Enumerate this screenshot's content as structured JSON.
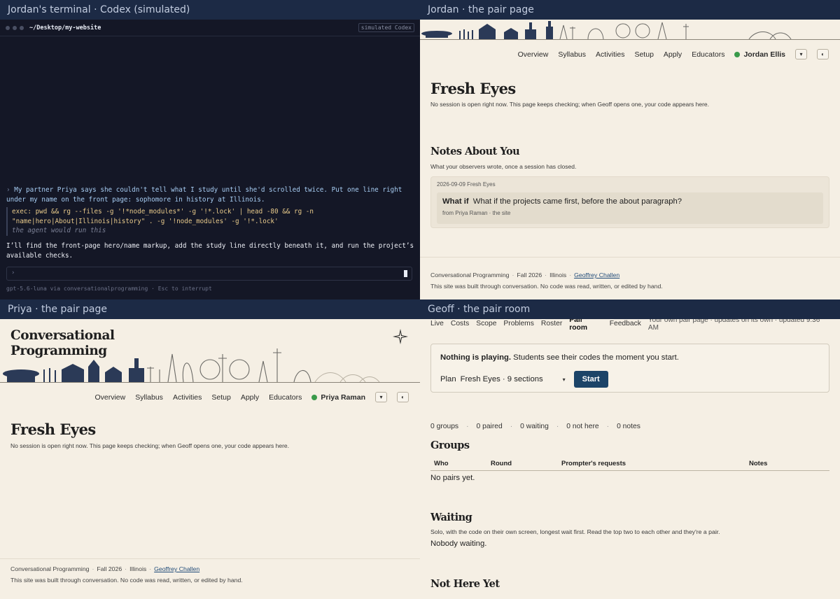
{
  "panes": {
    "tl_title": "Jordan's terminal · Codex (simulated)",
    "tr_title": "Jordan · the pair page",
    "bl_title": "Priya · the pair page",
    "br_title": "Geoff · the pair room"
  },
  "terminal": {
    "path": "~/Desktop/my-website",
    "badge": "simulated Codex",
    "prompt_chevron": "›",
    "user_message": "My partner Priya says she couldn't tell what I study until she'd scrolled twice. Put one line right under my name on the front page: sophomore in history at Illinois.",
    "exec_line": "exec: pwd && rg --files -g '!*node_modules*' -g '!*.lock' | head -80 && rg -n \"name|hero|About|Illinois|history\" . -g '!node_modules' -g '!*.lock'",
    "exec_hint": "the agent would run this",
    "reply": "I’ll find the front-page hero/name markup, add the study line directly beneath it, and run the project’s available checks.",
    "input_prompt": "›",
    "status": "gpt-5.6-luna via conversationalprogramming  ·  Esc to interrupt"
  },
  "site": {
    "nav": [
      "Overview",
      "Syllabus",
      "Activities",
      "Setup",
      "Apply",
      "Educators"
    ],
    "logo_line1": "Conversational",
    "logo_line2": "Programming",
    "footer_course": "Conversational Programming",
    "footer_term": "Fall 2026",
    "footer_place": "Illinois",
    "footer_author": "Geoffrey Challen",
    "footer_note": "This site was built through conversation. No code was read, written, or edited by hand.",
    "caret": "▾",
    "theme_glyph": "◐"
  },
  "jordan": {
    "user": "Jordan Ellis",
    "title": "Fresh Eyes",
    "subtitle": "No session is open right now. This page keeps checking; when Geoff opens one, your code appears here.",
    "notes_title": "Notes About You",
    "notes_sub": "What your observers wrote, once a session has closed.",
    "note_date": "2026-09-09 Fresh Eyes",
    "note_label": "What if",
    "note_text": "What if the projects came first, before the about paragraph?",
    "note_from": "from Priya Raman · the site"
  },
  "priya": {
    "user": "Priya Raman",
    "title": "Fresh Eyes",
    "subtitle": "No session is open right now. This page keeps checking; when Geoff opens one, your code appears here."
  },
  "geoff": {
    "nav": [
      "Live",
      "Costs",
      "Scope",
      "Problems",
      "Roster",
      "Pair room",
      "Feedback"
    ],
    "nav_right": "Your own pair page · updates on its own · updated 9:36 AM",
    "nothing_bold": "Nothing is playing.",
    "nothing_rest": " Students see their codes the moment you start.",
    "plan_label": "Plan",
    "plan_value": "Fresh Eyes · 9 sections",
    "start_label": "Start",
    "stats": [
      "0 groups",
      "0 paired",
      "0 waiting",
      "0 not here",
      "0 notes"
    ],
    "groups_title": "Groups",
    "groups_cols": [
      "Who",
      "Round",
      "Prompter's requests",
      "Notes"
    ],
    "groups_empty": "No pairs yet.",
    "waiting_title": "Waiting",
    "waiting_sub": "Solo, with the code on their own screen, longest wait first. Read the top two to each other and they're a pair.",
    "waiting_empty": "Nobody waiting.",
    "nothere_title": "Not Here Yet"
  }
}
